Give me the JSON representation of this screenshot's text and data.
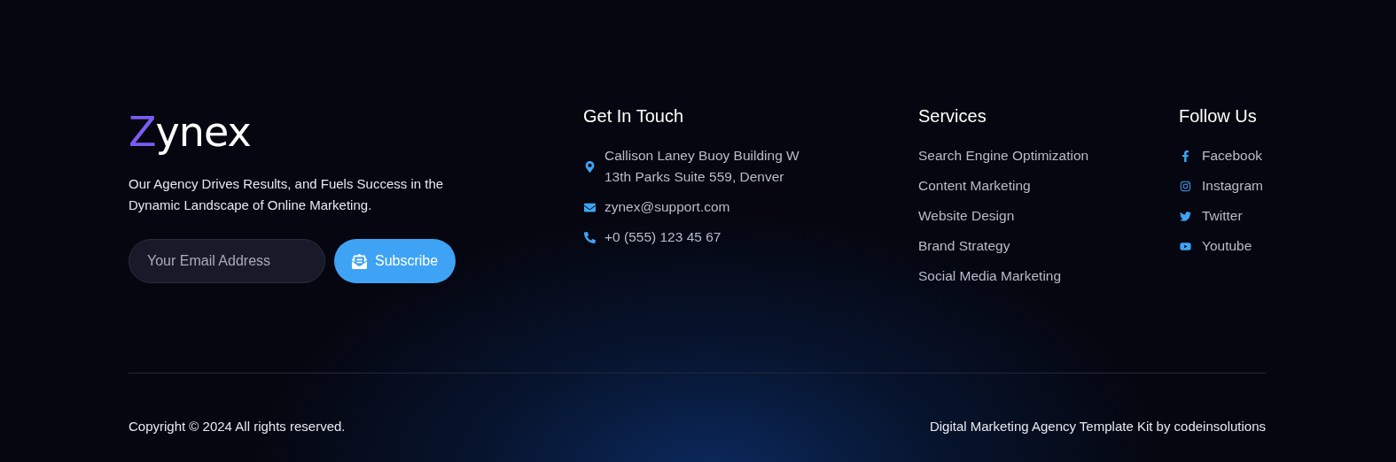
{
  "brand": {
    "logo": "Zynex",
    "tagline": "Our Agency Drives Results, and Fuels Success in the Dynamic Landscape of Online Marketing."
  },
  "newsletter": {
    "placeholder": "Your Email Address",
    "button": "Subscribe"
  },
  "contact": {
    "title": "Get In Touch",
    "items": [
      {
        "kind": "address",
        "text": "Callison Laney Buoy Building W 13th Parks Suite 559, Denver"
      },
      {
        "kind": "email",
        "text": "zynex@support.com"
      },
      {
        "kind": "phone",
        "text": "+0 (555) 123 45 67"
      }
    ]
  },
  "services": {
    "title": "Services",
    "items": [
      "Search Engine Optimization",
      "Content Marketing",
      "Website Design",
      "Brand Strategy",
      "Social Media Marketing"
    ]
  },
  "follow": {
    "title": "Follow Us",
    "items": [
      {
        "kind": "facebook",
        "label": "Facebook"
      },
      {
        "kind": "instagram",
        "label": "Instagram"
      },
      {
        "kind": "twitter",
        "label": "Twitter"
      },
      {
        "kind": "youtube",
        "label": "Youtube"
      }
    ]
  },
  "bottom": {
    "copyright": "Copyright © 2024 All rights reserved.",
    "credit": "Digital Marketing Agency Template Kit by codeinsolutions"
  }
}
